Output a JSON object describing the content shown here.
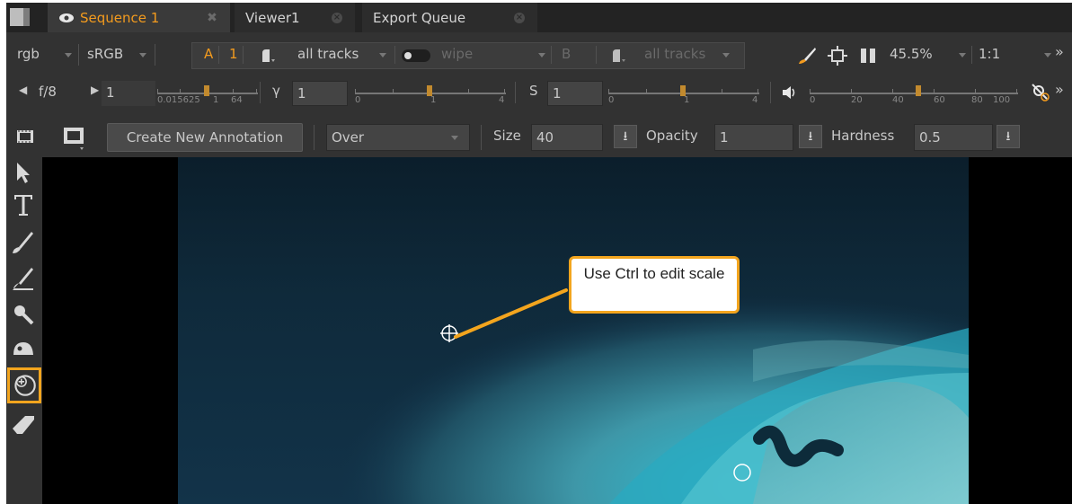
{
  "tabs": [
    {
      "label": "Sequence 1",
      "active": true
    },
    {
      "label": "Viewer1",
      "active": false
    },
    {
      "label": "Export Queue",
      "active": false
    }
  ],
  "viewer_controls": {
    "channels": "rgb",
    "colorspace": "sRGB",
    "input_a": "A",
    "input_a_num": "1",
    "tracks_a": "all tracks",
    "wipe": "wipe",
    "input_b": "B",
    "tracks_b": "all tracks",
    "zoom": "45.5%",
    "ratio": "1:1"
  },
  "exposure": {
    "fstop": "f/8",
    "gain_value": "1",
    "gain_ticks": [
      "0.015625",
      "1",
      "64"
    ],
    "gamma_label": "γ",
    "gamma_value": "1",
    "gamma_ticks": [
      "0",
      "1",
      "4"
    ],
    "sat_label": "S",
    "sat_value": "1",
    "sat_ticks": [
      "0",
      "1",
      "4"
    ],
    "volume_ticks": [
      "0",
      "20",
      "40",
      "60",
      "80",
      "100"
    ]
  },
  "annotation": {
    "create_button": "Create New Annotation",
    "blend_mode": "Over",
    "size_label": "Size",
    "size_value": "40",
    "opacity_label": "Opacity",
    "opacity_value": "1",
    "hardness_label": "Hardness",
    "hardness_value": "0.5"
  },
  "callout_text": "Use Ctrl to edit scale",
  "tools": [
    "select-arrow",
    "text",
    "brush",
    "pen",
    "pick",
    "erase-blob",
    "clone",
    "eraser"
  ],
  "colors": {
    "accent": "#f39b1e",
    "highlight": "#f3a51e"
  }
}
